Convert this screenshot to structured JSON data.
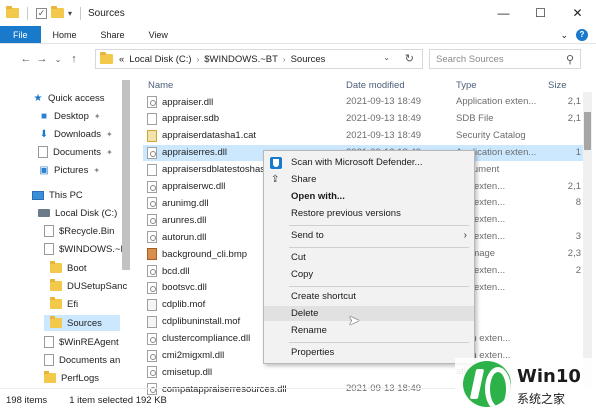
{
  "window": {
    "title": "Sources",
    "controls": [
      "—",
      "☐",
      "✕"
    ]
  },
  "ribbon": {
    "tabs": [
      "File",
      "Home",
      "Share",
      "View"
    ]
  },
  "address": {
    "crumbs": [
      "«",
      "Local Disk (C:)",
      "$WINDOWS.~BT",
      "Sources"
    ]
  },
  "search": {
    "placeholder": "Search Sources"
  },
  "columns": {
    "name": "Name",
    "date": "Date modified",
    "type": "Type",
    "size": "Size"
  },
  "nav": {
    "items": [
      {
        "label": "Quick access",
        "icon": "star-icon"
      },
      {
        "label": "Desktop",
        "icon": "desktop-icon"
      },
      {
        "label": "Downloads",
        "icon": "download-icon"
      },
      {
        "label": "Documents",
        "icon": "documents-icon"
      },
      {
        "label": "Pictures",
        "icon": "pictures-icon"
      },
      {
        "label": "This PC",
        "icon": "pc-icon"
      },
      {
        "label": "Local Disk (C:)",
        "icon": "drive-icon"
      },
      {
        "label": "$Recycle.Bin",
        "icon": "folder-icon"
      },
      {
        "label": "$WINDOWS.~E",
        "icon": "folder-icon"
      },
      {
        "label": "Boot",
        "icon": "folder-icon"
      },
      {
        "label": "DUSetupSanc",
        "icon": "folder-icon"
      },
      {
        "label": "Efi",
        "icon": "folder-icon"
      },
      {
        "label": "Sources",
        "icon": "folder-icon"
      },
      {
        "label": "$WinREAgent",
        "icon": "folder-icon"
      },
      {
        "label": "Documents an",
        "icon": "folder-icon"
      },
      {
        "label": "PerfLogs",
        "icon": "folder-icon"
      }
    ]
  },
  "files": [
    {
      "name": "appraiser.dll",
      "date": "2021-09-13 18:49",
      "type": "Application exten...",
      "size": "2,1",
      "icon": "dll"
    },
    {
      "name": "appraiser.sdb",
      "date": "2021-09-13 18:49",
      "type": "SDB File",
      "size": "2,1",
      "icon": "sdb"
    },
    {
      "name": "appraiserdatasha1.cat",
      "date": "2021-09-13 18:49",
      "type": "Security Catalog",
      "size": "",
      "icon": "cat"
    },
    {
      "name": "appraiserres.dll",
      "date": "2021-09-13 18:49",
      "type": "Application exten...",
      "size": "1",
      "icon": "dll"
    },
    {
      "name": "appraisersdblatestoshash",
      "date": "",
      "type": "Document",
      "size": "",
      "icon": "sdb"
    },
    {
      "name": "appraiserwc.dll",
      "date": "",
      "type": "tion exten...",
      "size": "2,1",
      "icon": "dll"
    },
    {
      "name": "arunimg.dll",
      "date": "",
      "type": "tion exten...",
      "size": "8",
      "icon": "dll"
    },
    {
      "name": "arunres.dll",
      "date": "",
      "type": "tion exten...",
      "size": "",
      "icon": "dll"
    },
    {
      "name": "autorun.dll",
      "date": "",
      "type": "tion exten...",
      "size": "3",
      "icon": "dll"
    },
    {
      "name": "background_cli.bmp",
      "date": "",
      "type": "ap image",
      "size": "2,3",
      "icon": "bmp"
    },
    {
      "name": "bcd.dll",
      "date": "",
      "type": "tion exten...",
      "size": "2",
      "icon": "dll"
    },
    {
      "name": "bootsvc.dll",
      "date": "",
      "type": "tion exten...",
      "size": "",
      "icon": "dll"
    },
    {
      "name": "cdplib.mof",
      "date": "",
      "type": "File",
      "size": "",
      "icon": "mof"
    },
    {
      "name": "cdplibuninstall.mof",
      "date": "",
      "type": "File",
      "size": "",
      "icon": "mof"
    },
    {
      "name": "clustercompliance.dll",
      "date": "",
      "type": "ation exten...",
      "size": "",
      "icon": "dll"
    },
    {
      "name": "cmi2migxml.dll",
      "date": "",
      "type": "ation exten...",
      "size": "",
      "icon": "dll"
    },
    {
      "name": "cmisetup.dll",
      "date": "",
      "type": "ation exten...",
      "size": "",
      "icon": "dll"
    },
    {
      "name": "compatappraiserresources.dll",
      "date": "2021-09-13 18:49",
      "type": "",
      "size": "",
      "icon": "dll"
    }
  ],
  "context_menu": {
    "items": [
      "Scan with Microsoft Defender...",
      "Share",
      "Open with...",
      "Restore previous versions",
      "Send to",
      "Cut",
      "Copy",
      "Create shortcut",
      "Delete",
      "Rename",
      "Properties"
    ]
  },
  "status": {
    "items_count": "198 items",
    "selection": "1 item selected  192 KB"
  },
  "watermark": {
    "title": "Win10",
    "subtitle": "系统之家"
  }
}
